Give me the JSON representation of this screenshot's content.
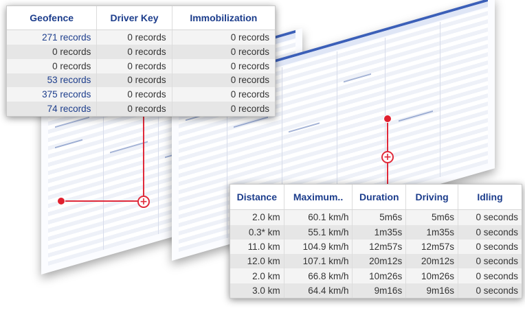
{
  "top_table": {
    "headers": [
      "Geofence",
      "Driver Key",
      "Immobilization"
    ],
    "rows": [
      [
        "271 records",
        "0 records",
        "0 records"
      ],
      [
        "0 records",
        "0 records",
        "0 records"
      ],
      [
        "0 records",
        "0 records",
        "0 records"
      ],
      [
        "53 records",
        "0 records",
        "0 records"
      ],
      [
        "375 records",
        "0 records",
        "0 records"
      ],
      [
        "74 records",
        "0 records",
        "0 records"
      ]
    ],
    "linked_first_column": [
      true,
      false,
      false,
      true,
      true,
      true
    ]
  },
  "bottom_table": {
    "headers": [
      "Distance",
      "Maximum..",
      "Duration",
      "Driving",
      "Idling"
    ],
    "rows": [
      [
        "2.0 km",
        "60.1 km/h",
        "5m6s",
        "5m6s",
        "0 seconds"
      ],
      [
        "0.3* km",
        "55.1 km/h",
        "1m35s",
        "1m35s",
        "0 seconds"
      ],
      [
        "11.0 km",
        "104.9 km/h",
        "12m57s",
        "12m57s",
        "0 seconds"
      ],
      [
        "12.0 km",
        "107.1 km/h",
        "20m12s",
        "20m12s",
        "0 seconds"
      ],
      [
        "2.0 km",
        "66.8 km/h",
        "10m26s",
        "10m26s",
        "0 seconds"
      ],
      [
        "3.0 km",
        "64.4 km/h",
        "9m16s",
        "9m16s",
        "0 seconds"
      ]
    ]
  },
  "icons": {
    "zoom": "zoom-plus-icon"
  },
  "colors": {
    "header_text": "#1c3d8c",
    "callout": "#e02a3a"
  }
}
